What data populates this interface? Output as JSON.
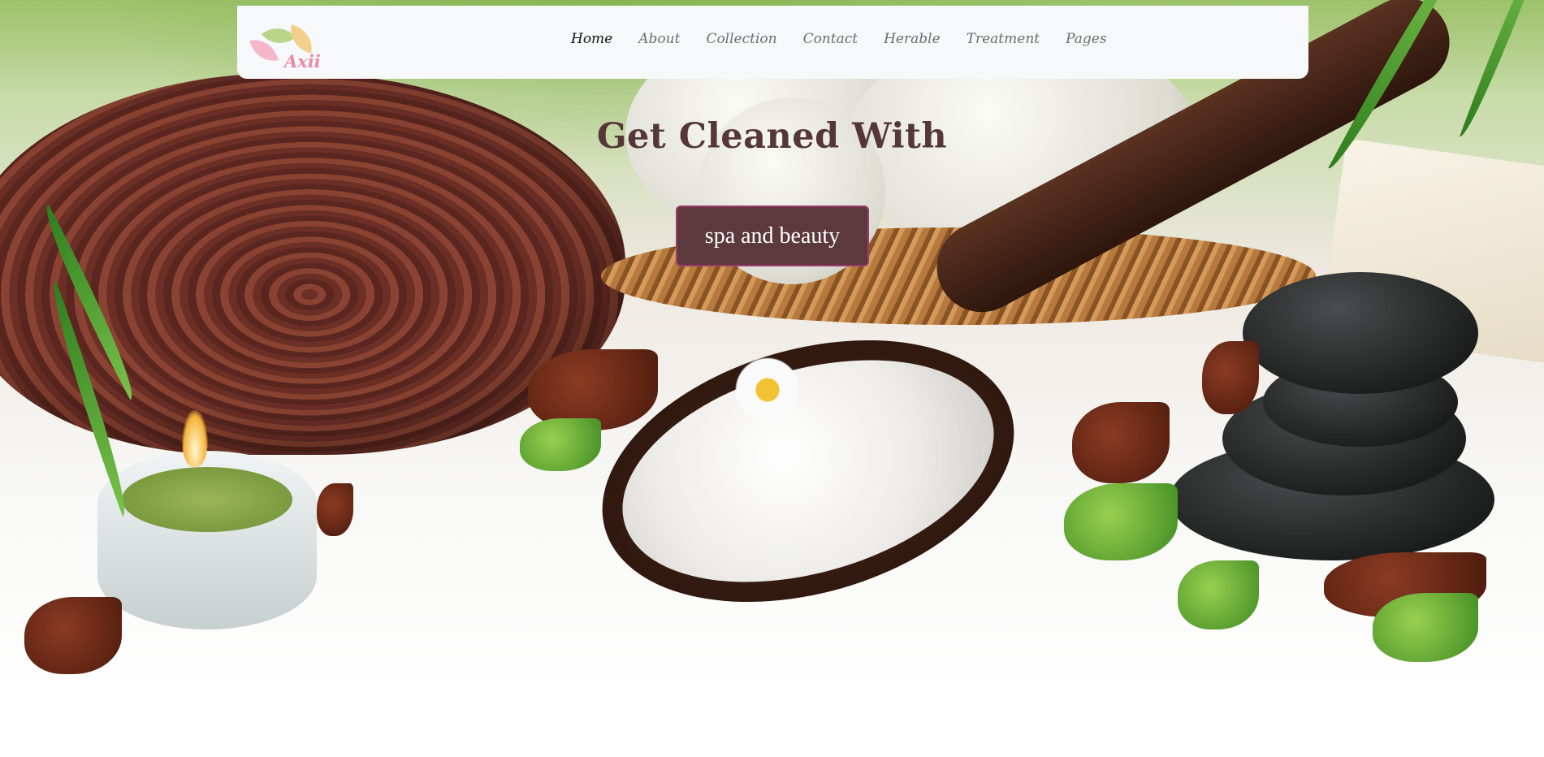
{
  "brand": {
    "logo_text": "Axii"
  },
  "nav": {
    "items": [
      {
        "label": "Home",
        "active": true
      },
      {
        "label": "About"
      },
      {
        "label": "Collection"
      },
      {
        "label": "Contact"
      },
      {
        "label": "Herable"
      },
      {
        "label": "Treatment"
      },
      {
        "label": "Pages"
      }
    ]
  },
  "hero": {
    "headline": "Get Cleaned With",
    "cta_label": "spa and beauty",
    "image_description_icon": "spa-still-life-image"
  },
  "colors": {
    "headline": "#553737",
    "cta_bg": "#5b393d",
    "cta_border": "#9a3c6b",
    "nav_bg": "#f6f8fa",
    "logo_text": "#e98aa7"
  }
}
